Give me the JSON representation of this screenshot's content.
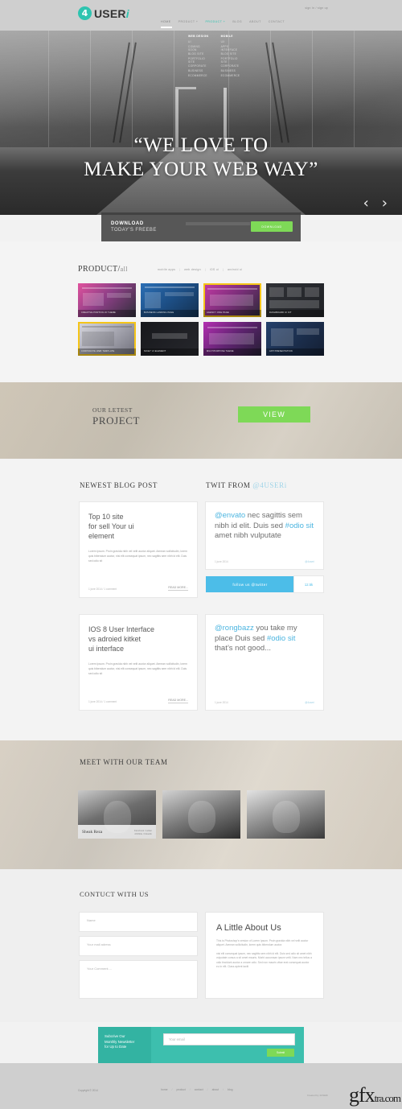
{
  "header": {
    "logo_badge": "4",
    "logo_text": "USER",
    "logo_accent": "i",
    "topright": "sign in  /  sign up",
    "nav": [
      {
        "label": "HOME",
        "state": "active"
      },
      {
        "label": "PRODUCT +",
        "state": "open"
      },
      {
        "label": "PRODUCT +",
        "state": "teal"
      },
      {
        "label": "BLOG",
        "state": "normal"
      },
      {
        "label": "ABOUT",
        "state": "normal"
      },
      {
        "label": "CONTACT",
        "state": "normal"
      }
    ],
    "dropdown": {
      "col1_head": "WEB DESIGN",
      "col1_items": [
        "UI",
        "COMING SOON",
        "BLOG SITE",
        "PORTFOLIO SITE",
        "CORPORATE",
        "BUSINESS",
        "ECOMMERCE"
      ],
      "col2_head": "MOBILE",
      "col2_items": [
        "UX",
        "APPS INTERFACE",
        "BLOG SITE",
        "PORTFOLIO SITE",
        "CORPORATE",
        "BUSINESS",
        "ECOMMERCE"
      ]
    }
  },
  "hero": {
    "line1": "“WE LOVE TO",
    "line2": "MAKE YOUR WEB WAY”",
    "prev_icon": "‹",
    "next_icon": "›"
  },
  "download": {
    "title": "DOWNLOAD",
    "subtitle": "TODAY’S FREEBE",
    "button": "DOWNLOAD"
  },
  "product": {
    "heading": "PRODUCT/",
    "heading_suffix": "all",
    "filters": [
      "mobile apps",
      "web design",
      "iOS ui",
      "android ui"
    ],
    "separator": "|",
    "tiles": [
      {
        "name": "tile-1",
        "theme": "t-pink",
        "selected": false,
        "caption": "CREATIVE PORTFOLIO THEME"
      },
      {
        "name": "tile-2",
        "theme": "t-blue",
        "selected": false,
        "caption": "BUSINESS LANDING PAGE"
      },
      {
        "name": "tile-3",
        "theme": "t-magenta",
        "selected": true,
        "caption": "AGENCY ONE PAGE"
      },
      {
        "name": "tile-4",
        "theme": "t-dark",
        "selected": false,
        "caption": "DASHBOARD UI KIT"
      },
      {
        "name": "tile-5",
        "theme": "t-web",
        "selected": true,
        "caption": "CORPORATE WEB TEMPLATE"
      },
      {
        "name": "tile-6",
        "theme": "t-black",
        "selected": false,
        "caption": "NICEY UI ELEMENT"
      },
      {
        "name": "tile-7",
        "theme": "t-purple",
        "selected": false,
        "caption": "MULTIPURPOSE THEME"
      },
      {
        "name": "tile-8",
        "theme": "t-navy",
        "selected": false,
        "caption": "APP PRESENTATION"
      }
    ]
  },
  "latest": {
    "line1": "OUR LETEST",
    "line2": "PROJECT",
    "button": "VIEW"
  },
  "blog": {
    "heading": "NEWEST BLOG POST",
    "posts": [
      {
        "title": "Top 10 site\nfor sell Your ui\nelement",
        "body": "Lorem Ipsum. Proin gravida nibh vel velit auctor aliquet. Aenean sollicitudin, lorem quis bibendum auctor, nisi elit consequat ipsum, nec sagittis sem nibh id elit. Duis sed odio sit",
        "meta": "1 june 2014 / 1 comment",
        "more": "READ MORE..."
      },
      {
        "title": "IOS 8 User Interface\nvs adroied kitket\nui interface",
        "body": "Lorem Ipsum. Proin gravida nibh vel velit auctor aliquet. Aenean sollicitudin, lorem quis bibendum auctor, nisi elit consequat ipsum, nec sagittis sem nibh id elit. Duis sed odio sit",
        "meta": "1 june 2014 / 1 comment",
        "more": "READ MORE..."
      }
    ]
  },
  "twitter": {
    "heading": "TWIT FROM ",
    "handle": "@4USERi",
    "tweets": [
      {
        "p1": "@envato",
        "p2": " nec sagittis sem nibh id elit. Duis sed ",
        "p3": "#odio sit",
        "p4": " amet nibh vulputate",
        "meta": "1 june 2014",
        "via": "@4useri"
      },
      {
        "p1": "@rongbazz",
        "p2": " you take my place Duis sed ",
        "p3": "#odio sit",
        "p4": " that’s not good...",
        "meta": "1 june 2014",
        "via": "@4useri"
      }
    ],
    "follow_label": "follow us @twitter",
    "follow_count": "12.5k"
  },
  "team": {
    "heading": "MEET WITH OUR TEAM",
    "members": [
      {
        "name": "Sheak Reza",
        "role": "Facebook / twitter\ndribbble / linkedin"
      },
      {
        "name": "",
        "role": ""
      },
      {
        "name": "",
        "role": ""
      }
    ]
  },
  "contact": {
    "heading": "CONTUCT WITH US",
    "fields": [
      {
        "placeholder": "Name"
      },
      {
        "placeholder": "Your mail adress"
      },
      {
        "placeholder": "Your Comment...."
      }
    ],
    "about_title": "A Little About Us",
    "about_p1": "This is Photoshop’s version of Lorem Ipsum. Proin gravida nibh vel velit auctor aliquet. Aenean sollicitudin, lorem quis bibendum auctor.",
    "about_p2": "nisi elit consequat ipsum, nec sagittis sem nibh id elit. Duis sed odio sit amet nibh vulputate cursus a sit amet mauris. Morbi accumsan ipsum velit. Nam nec tellus a odio tincidunt auctor a ornare odio. Sed non mauris vitae erat consequat auctor eu in elit. Class aptent taciti"
  },
  "newsletter": {
    "l1": "Subcrive Our",
    "l2": "Monthly Newsletter",
    "l3": "for Up to Date",
    "placeholder": "Your email",
    "button": "Submit"
  },
  "footer": {
    "copyright": "Copyright © 2014",
    "nav": [
      "home",
      "product",
      "contact",
      "about",
      "blog"
    ],
    "separator": "/",
    "credit": "Created by 4USERi",
    "watermark": "gfx",
    "watermark_small": "tra.com"
  }
}
